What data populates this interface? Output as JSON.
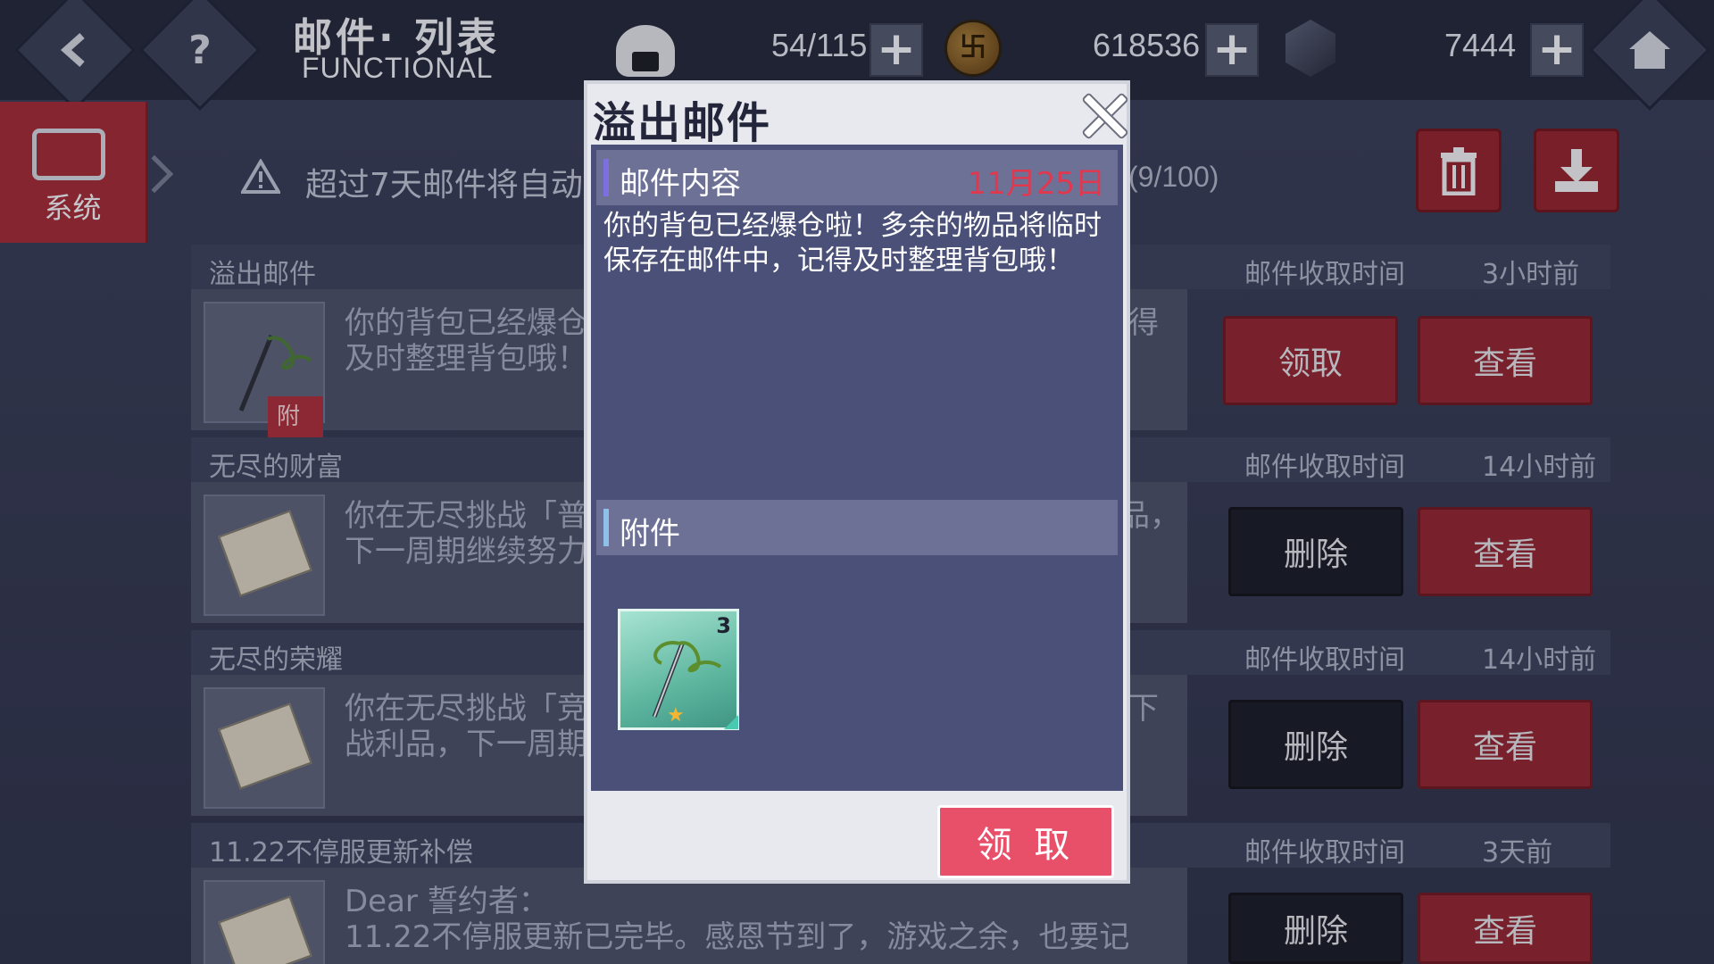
{
  "header": {
    "title": "邮件· 列表",
    "subtitle": "FUNCTIONAL",
    "stamina": "54/115",
    "coins": "618536",
    "gems": "7444",
    "coin_glyph": "卐"
  },
  "sidebar": {
    "system_label": "系统"
  },
  "notice": {
    "text": "超过7天邮件将自动",
    "count": "(9/100)"
  },
  "mails": [
    {
      "name": "溢出邮件",
      "time_label": "邮件收取时间",
      "ago": "3小时前",
      "text": "你的背包已经爆仓\n及时整理背包哦！",
      "tail": "得",
      "attach_tag": "附件",
      "btn1": "领取",
      "btn2": "查看"
    },
    {
      "name": "无尽的财富",
      "time_label": "邮件收取时间",
      "ago": "14小时前",
      "text": "你在无尽挑战「普\n下一周期继续努力",
      "tail": "品，",
      "btn1": "删除",
      "btn2": "查看"
    },
    {
      "name": "无尽的荣耀",
      "time_label": "邮件收取时间",
      "ago": "14小时前",
      "text": "你在无尽挑战「竞\n战利品，下一周期",
      "tail": "下",
      "btn1": "删除",
      "btn2": "查看"
    },
    {
      "name": "11.22不停服更新补偿",
      "time_label": "邮件收取时间",
      "ago": "3天前",
      "text": "Dear 誓约者：\n      11.22不停服更新已完毕。感恩节到了，游戏之余，也要记",
      "btn1": "删除",
      "btn2": "查看"
    }
  ],
  "modal": {
    "title": "溢出邮件",
    "content_label": "邮件内容",
    "date": "11月25日",
    "message": "你的背包已经爆仓啦！多余的物品将临时保存在邮件中，记得及时整理背包哦！",
    "attachments_label": "附件",
    "item_count": "3",
    "item_star": "★",
    "claim_label": "领 取"
  }
}
